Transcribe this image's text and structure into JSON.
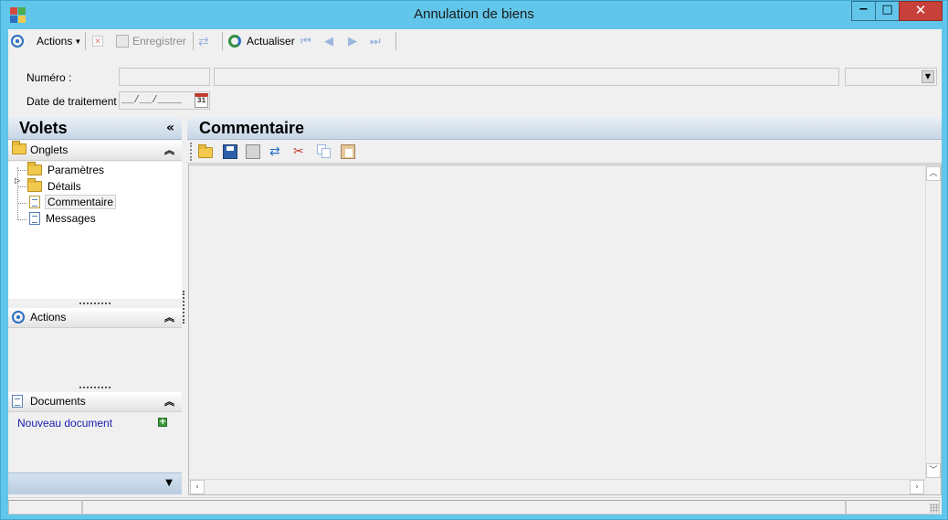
{
  "window": {
    "title": "Annulation de biens",
    "buttons": {
      "minimize": "−",
      "maximize": "□",
      "close": "✕"
    }
  },
  "toolbar": {
    "actions_label": "Actions",
    "save_label": "Enregistrer",
    "refresh_label": "Actualiser"
  },
  "form": {
    "numero_label": "Numéro :",
    "numero_value": "",
    "numero_desc": "",
    "numero_combo": "",
    "date_label": "Date de traitement :",
    "date_value": "__/__/____",
    "calendar_day": "31"
  },
  "left_pane": {
    "title": "Volets",
    "collapse_glyph": "«",
    "onglets": {
      "title": "Onglets",
      "items": [
        {
          "label": "Paramètres",
          "icon": "folder-icon"
        },
        {
          "label": "Détails",
          "icon": "folder-icon",
          "expandable": true
        },
        {
          "label": "Commentaire",
          "icon": "document-icon",
          "selected": true
        },
        {
          "label": "Messages",
          "icon": "document-icon"
        }
      ]
    },
    "actions": {
      "title": "Actions"
    },
    "documents": {
      "title": "Documents",
      "new_link": "Nouveau document",
      "add_glyph": "+"
    }
  },
  "right_pane": {
    "title": "Commentaire",
    "tools": [
      "open-folder-icon",
      "save-icon",
      "print-icon",
      "refresh-icon",
      "cut-icon",
      "copy-icon",
      "paste-icon"
    ],
    "content": ""
  },
  "colors": {
    "frame": "#62c6ea",
    "close_button": "#c7413a",
    "link": "#1a1ab0",
    "pane_header": "#c7d6e6"
  }
}
